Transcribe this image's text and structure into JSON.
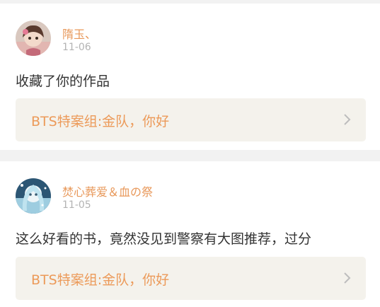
{
  "comments": [
    {
      "username": "隋玉、",
      "time": "11-06",
      "content": "收藏了你的作品",
      "work_title": "BTS特案组:金队，你好"
    },
    {
      "username": "焚心葬爱＆血の祭",
      "time": "11-05",
      "content": "这么好看的书，竟然没见到警察有大图推荐，过分",
      "work_title": "BTS特案组:金队，你好"
    }
  ],
  "colors": {
    "username": "#e8985a",
    "work_title": "#ec9a59",
    "work_link_bg": "#f4f2ec",
    "page_bg": "#f2f2f2"
  },
  "icons": [
    "avatar",
    "chevron-right-icon"
  ]
}
